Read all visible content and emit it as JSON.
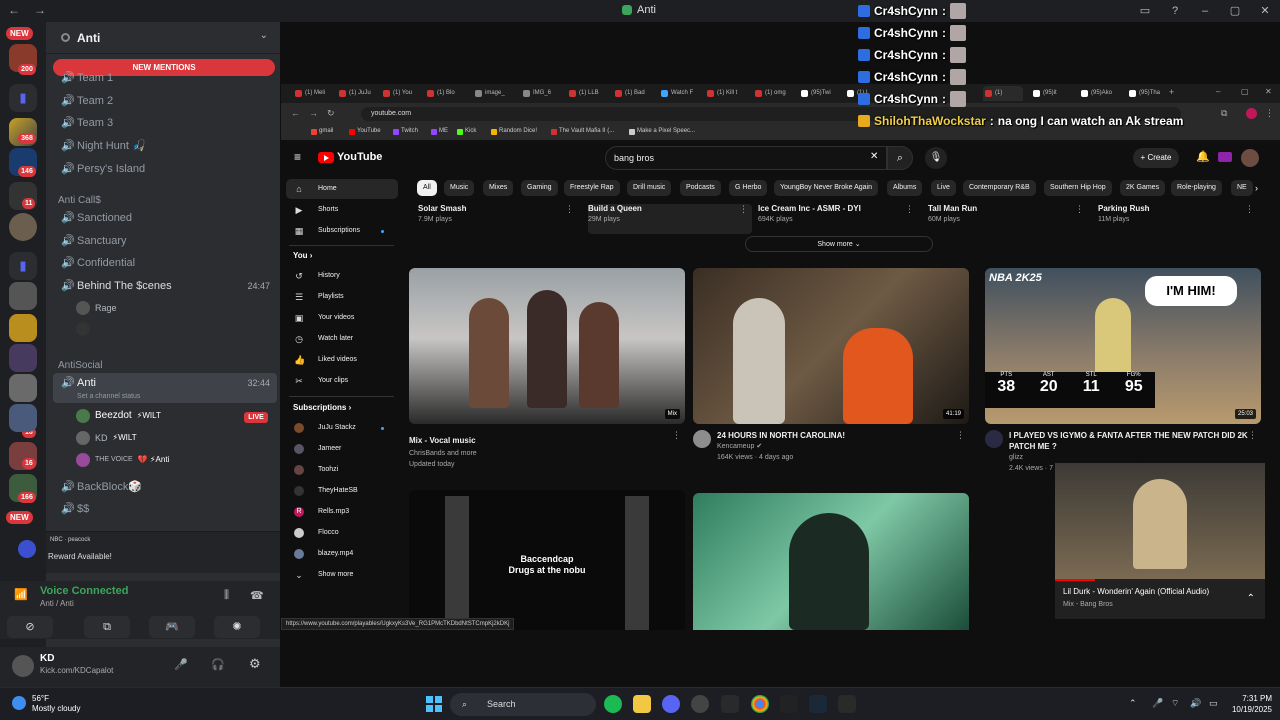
{
  "discord": {
    "window_title": "Anti",
    "guild_name": "Anti",
    "mentions_label": "NEW MENTIONS",
    "server_pills": {
      "new_top": "NEW",
      "count_200": "200",
      "badge_368": "368",
      "badge_146": "146",
      "badge_11": "11",
      "badge_16a": "16",
      "badge_16b": "16",
      "badge_166": "166",
      "new_bottom": "NEW"
    },
    "channels_top": [
      {
        "label": "Team 1"
      },
      {
        "label": "Team 2"
      },
      {
        "label": "Team 3"
      },
      {
        "label": "Night Hunt 🎣"
      },
      {
        "label": "Persy's Island"
      }
    ],
    "category_calls": "Anti Call$",
    "channels_calls": [
      {
        "label": "Sanctioned"
      },
      {
        "label": "Sanctuary"
      },
      {
        "label": "Confidential"
      },
      {
        "label": "Behind The $cenes",
        "time": "24:47"
      }
    ],
    "rage_user": "Rage",
    "category_social": "AntiSocial",
    "active_channel": {
      "label": "Anti",
      "time": "32:44",
      "status": "Set a channel status"
    },
    "voice_users": [
      {
        "name": "Beezdot",
        "tag": "⚡WILT",
        "live": "LIVE"
      },
      {
        "name": "KD",
        "tag": "⚡WILT"
      },
      {
        "name": "THE VOICE",
        "tag": "💔 ⚡Anti"
      }
    ],
    "channels_bottom": [
      {
        "label": "BackBlock🎲"
      },
      {
        "label": "$$"
      }
    ],
    "reward": {
      "brands": "NBC · peacock",
      "text": "Reward Available!"
    },
    "voice": {
      "status": "Voice Connected",
      "location": "Anti / Anti"
    },
    "user": {
      "name": "KD",
      "sub": "Kick.com/KDCapalot"
    }
  },
  "chat_overlay": [
    {
      "name": "Cr4shCynn",
      "sep": ":"
    },
    {
      "name": "Cr4shCynn",
      "sep": ":"
    },
    {
      "name": "Cr4shCynn",
      "sep": ":"
    },
    {
      "name": "Cr4shCynn",
      "sep": ":"
    },
    {
      "name": "Cr4shCynn",
      "sep": ":"
    },
    {
      "name": "ShilohThaWockstar",
      "sep": ":",
      "text": "na ong I can watch an Ak stream"
    }
  ],
  "browser": {
    "tabs": [
      "(1) Meli",
      "(1) JuJu",
      "(1) You",
      "(1) Blo",
      "image_",
      "IMG_6",
      "(1) LLB",
      "(1) Bad",
      "Watch F",
      "(1) Kill t",
      "(1) omg",
      "(95)Twi",
      "(1) L",
      "(1)",
      "(95)it",
      "(95)Ako",
      "(95)Tha"
    ],
    "url": "youtube.com",
    "bookmarks": [
      "gmail",
      "YouTube",
      "Twitch",
      "ME",
      "Kick",
      "Random Dice!",
      "The Vault Mafia II (...",
      "Make a Pixel Speec..."
    ]
  },
  "youtube": {
    "logo": "YouTube",
    "search_query": "bang bros",
    "create_label": "Create",
    "guide_main": [
      {
        "label": "Home",
        "icon": "home-icon"
      },
      {
        "label": "Shorts",
        "icon": "shorts-icon"
      },
      {
        "label": "Subscriptions",
        "icon": "subscriptions-icon"
      }
    ],
    "you_label": "You",
    "guide_you": [
      {
        "label": "History"
      },
      {
        "label": "Playlists"
      },
      {
        "label": "Your videos"
      },
      {
        "label": "Watch later"
      },
      {
        "label": "Liked videos"
      },
      {
        "label": "Your clips"
      }
    ],
    "subs_label": "Subscriptions",
    "guide_subs": [
      {
        "label": "JuJu Stackz"
      },
      {
        "label": "Jameer"
      },
      {
        "label": "Toohzi"
      },
      {
        "label": "TheyHateSB"
      },
      {
        "label": "Rells.mp3"
      },
      {
        "label": "Flocco"
      },
      {
        "label": "blazey.mp4"
      },
      {
        "label": "Show more"
      }
    ],
    "chips": [
      "All",
      "Music",
      "Mixes",
      "Gaming",
      "Freestyle Rap",
      "Drill music",
      "Podcasts",
      "G Herbo",
      "YoungBoy Never Broke Again",
      "Albums",
      "Live",
      "Contemporary R&B",
      "Southern Hip Hop",
      "2K Games",
      "Role-playing",
      "NE"
    ],
    "shorts": [
      {
        "title": "Solar Smash",
        "views": "7.9M plays"
      },
      {
        "title": "Build a Queen",
        "views": "29M plays"
      },
      {
        "title": "Ice Cream Inc - ASMR - DYI",
        "views": "694K plays"
      },
      {
        "title": "Tall Man Run",
        "views": "60M plays"
      },
      {
        "title": "Parking Rush",
        "views": "11M plays"
      }
    ],
    "show_more": "Show more",
    "videos": [
      {
        "title": "Mix - Vocal music",
        "line1": "ChrisBands and more",
        "line2": "Updated today",
        "badge": "Mix"
      },
      {
        "title": "24 HOURS IN NORTH CAROLINA!",
        "line1": "Kencameup",
        "line2": "164K views · 4 days ago",
        "badge": "41:19"
      },
      {
        "title": "I PLAYED VS IGYMO & FANTA AFTER THE NEW PATCH DID 2K PATCH ME ?",
        "line1": "glizz",
        "line2": "2.4K views · 7",
        "badge": "25:03"
      }
    ],
    "nba_thumb": {
      "logo": "NBA 2K25",
      "bubble": "I'M HIM!",
      "stats": [
        {
          "k": "PTS",
          "v": "38"
        },
        {
          "k": "AST",
          "v": "20"
        },
        {
          "k": "STL",
          "v": "11"
        },
        {
          "k": "FG%",
          "v": "95"
        }
      ]
    },
    "row2_caption": {
      "line1": "Baccendcap",
      "line2": "Drugs at the nobu"
    },
    "miniplayer": {
      "title": "Lil Durk - Wonderin' Again (Official Audio)",
      "sub": "Mix - Bang Bros"
    },
    "status_url": "https://www.youtube.com/playables/UgkxyKs3Ve_RG1PMcTKDbdNtSTCmpKj2kDKj"
  },
  "taskbar": {
    "weather_temp": "56°F",
    "weather_desc": "Mostly cloudy",
    "search": "Search",
    "time": "7:31 PM",
    "date": "10/19/2025"
  }
}
